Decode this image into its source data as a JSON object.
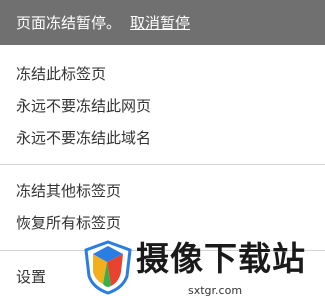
{
  "banner": {
    "message": "页面冻结暂停。",
    "cancel_link": "取消暂停"
  },
  "menu": {
    "freeze_this_tab": "冻结此标签页",
    "never_freeze_page": "永远不要冻结此网页",
    "never_freeze_domain": "永远不要冻结此域名",
    "freeze_other_tabs": "冻结其他标签页",
    "restore_all_tabs": "恢复所有标签页",
    "settings": "设置"
  },
  "watermark": {
    "title": "摄像下载站",
    "url": "sxtgr.com"
  },
  "colors": {
    "banner_bg": "#707070",
    "separator": "#d4d4d4",
    "text": "#333333"
  }
}
